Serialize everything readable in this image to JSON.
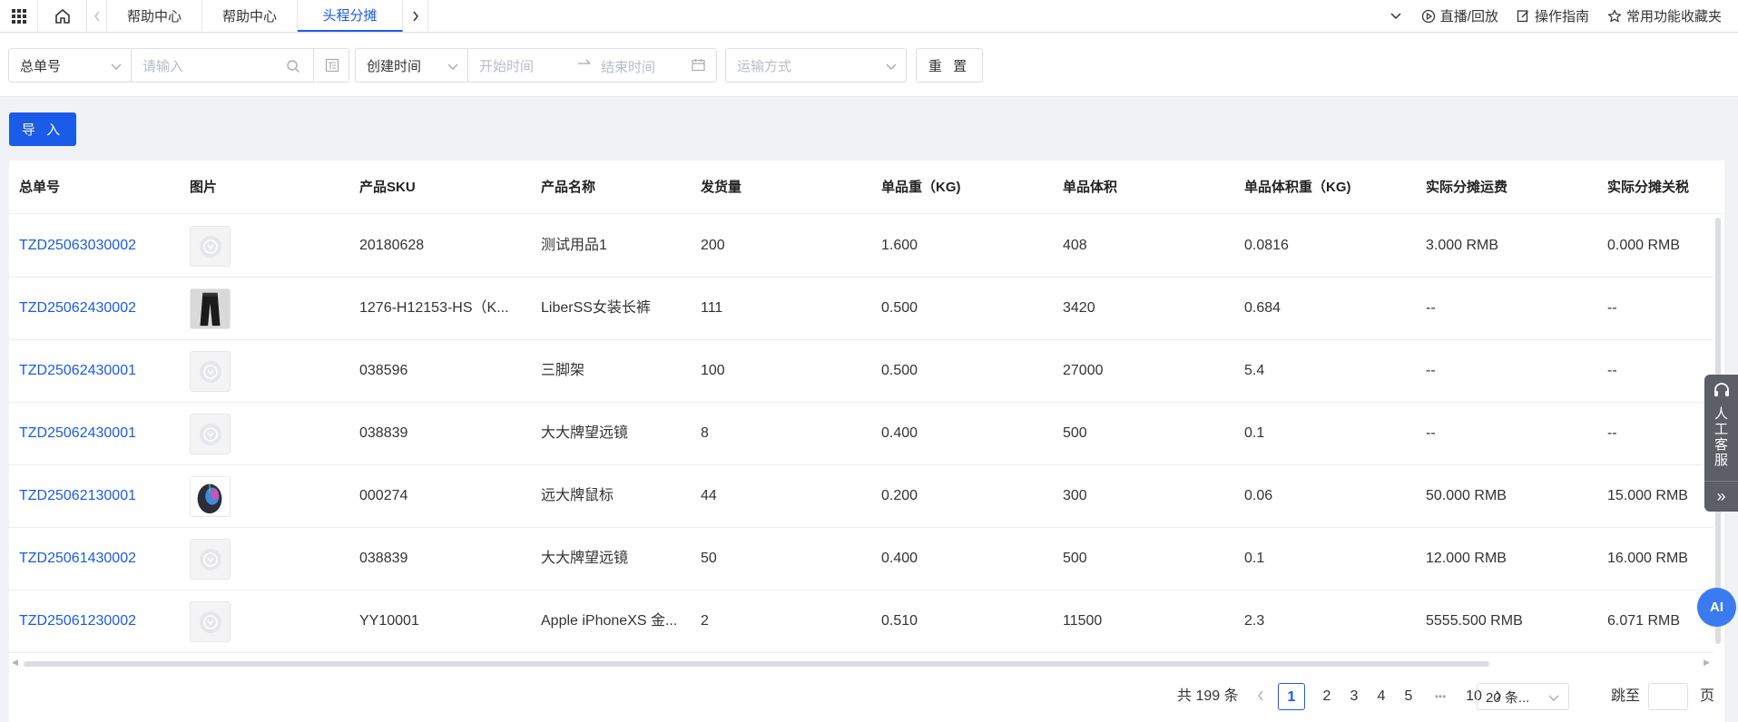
{
  "topbar": {
    "tabs": [
      {
        "label": "帮助中心"
      },
      {
        "label": "帮助中心"
      },
      {
        "label": "头程分摊"
      }
    ],
    "tools": {
      "live": "直播/回放",
      "guide": "操作指南",
      "favorites": "常用功能收藏夹"
    }
  },
  "filters": {
    "order_field": "总单号",
    "search_placeholder": "请输入",
    "time_field": "创建时间",
    "start_placeholder": "开始时间",
    "end_placeholder": "结束时间",
    "shipping_placeholder": "运输方式",
    "reset_label": "重 置"
  },
  "import_label": "导 入",
  "table": {
    "headers": [
      "总单号",
      "图片",
      "产品SKU",
      "产品名称",
      "发货量",
      "单品重（KG)",
      "单品体积",
      "单品体积重（KG)",
      "实际分摊运费",
      "实际分摊关税"
    ],
    "rows": [
      {
        "order": "TZD25063030002",
        "img": "placeholder",
        "sku": "20180628",
        "name": "测试用品1",
        "qty": "200",
        "weight": "1.600",
        "volume": "408",
        "vol_weight": "0.0816",
        "freight": "3.000 RMB",
        "tax": "0.000 RMB"
      },
      {
        "order": "TZD25062430002",
        "img": "pants",
        "sku": "1276-H12153-HS（K...",
        "name": "LiberSS女装长裤",
        "qty": "111",
        "weight": "0.500",
        "volume": "3420",
        "vol_weight": "0.684",
        "freight": "--",
        "tax": "--"
      },
      {
        "order": "TZD25062430001",
        "img": "placeholder",
        "sku": "038596",
        "name": "三脚架",
        "qty": "100",
        "weight": "0.500",
        "volume": "27000",
        "vol_weight": "5.4",
        "freight": "--",
        "tax": "--"
      },
      {
        "order": "TZD25062430001",
        "img": "placeholder",
        "sku": "038839",
        "name": "大大牌望远镜",
        "qty": "8",
        "weight": "0.400",
        "volume": "500",
        "vol_weight": "0.1",
        "freight": "--",
        "tax": "--"
      },
      {
        "order": "TZD25062130001",
        "img": "mouse",
        "sku": "000274",
        "name": "远大牌鼠标",
        "qty": "44",
        "weight": "0.200",
        "volume": "300",
        "vol_weight": "0.06",
        "freight": "50.000 RMB",
        "tax": "15.000 RMB"
      },
      {
        "order": "TZD25061430002",
        "img": "placeholder",
        "sku": "038839",
        "name": "大大牌望远镜",
        "qty": "50",
        "weight": "0.400",
        "volume": "500",
        "vol_weight": "0.1",
        "freight": "12.000 RMB",
        "tax": "16.000 RMB"
      },
      {
        "order": "TZD25061230002",
        "img": "placeholder",
        "sku": "YY10001",
        "name": "Apple iPhoneXS 金...",
        "qty": "2",
        "weight": "0.510",
        "volume": "11500",
        "vol_weight": "2.3",
        "freight": "5555.500 RMB",
        "tax": "6.071 RMB"
      }
    ]
  },
  "pagination": {
    "total": "共 199 条",
    "pages": [
      "1",
      "2",
      "3",
      "4",
      "5"
    ],
    "ellipsis": "•••",
    "last": "10",
    "page_size": "20 条...",
    "jump_label": "跳至",
    "page_unit": "页"
  },
  "service": {
    "label": "人工客服",
    "collapse": "»"
  },
  "ai_label": "AI",
  "colors": {
    "primary": "#1a5be8",
    "service_bg": "#5c5f66",
    "ai_bg": "#3a7bf0"
  }
}
